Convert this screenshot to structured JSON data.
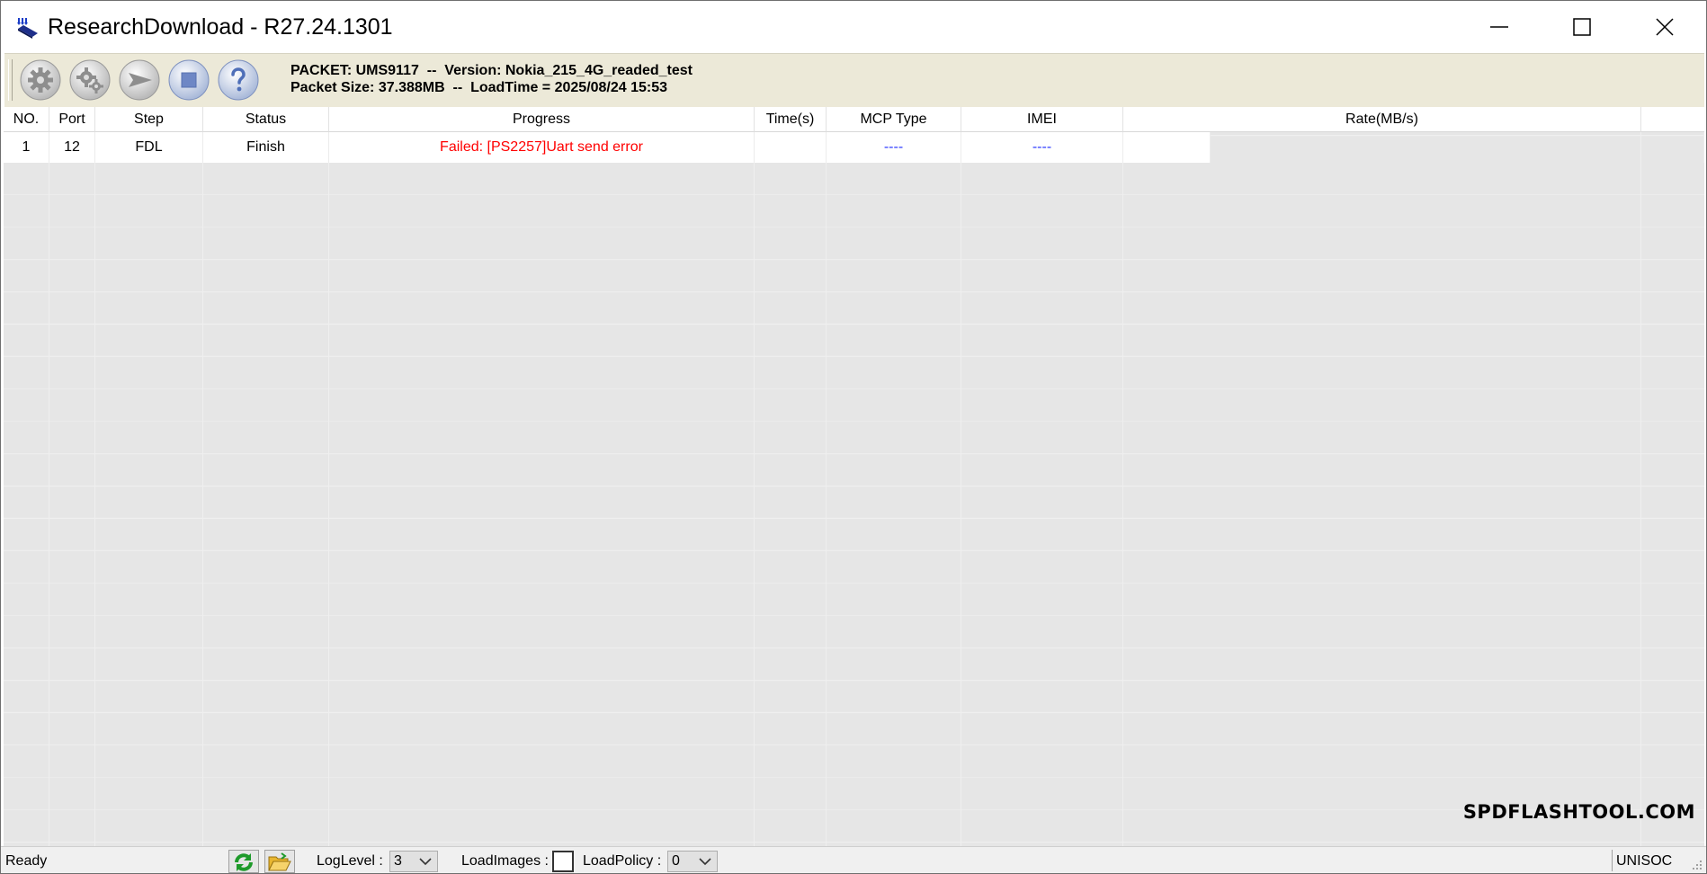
{
  "window": {
    "title": "ResearchDownload - R27.24.1301"
  },
  "toolbar": {
    "buttons": [
      {
        "name": "load-packet",
        "icon": "gear-icon"
      },
      {
        "name": "settings",
        "icon": "gears-icon"
      },
      {
        "name": "start",
        "icon": "play-arrow-icon"
      },
      {
        "name": "stop",
        "icon": "stop-icon"
      },
      {
        "name": "help",
        "icon": "help-icon"
      }
    ],
    "packet_line": "PACKET: UMS9117  --  Version: Nokia_215_4G_readed_test",
    "size_line": "Packet Size: 37.388MB  --  LoadTime = 2025/08/24 15:53"
  },
  "grid": {
    "columns": [
      "NO.",
      "Port",
      "Step",
      "Status",
      "Progress",
      "Time(s)",
      "MCP Type",
      "IMEI",
      "Rate(MB/s)"
    ],
    "rows": [
      {
        "no": "1",
        "port": "12",
        "step": "FDL",
        "status": "Finish",
        "progress": "Failed: [PS2257]Uart send error",
        "time": "",
        "mcp": "----",
        "imei": "----",
        "rate": ""
      }
    ]
  },
  "watermark": "SPDFLASHTOOL.COM",
  "statusbar": {
    "status": "Ready",
    "loglevel_label": "LogLevel :",
    "loglevel_value": "3",
    "loadimages_label": "LoadImages :",
    "loadpolicy_label": "LoadPolicy :",
    "loadpolicy_value": "0",
    "vendor": "UNISOC"
  },
  "colors": {
    "toolbar_bg": "#ece9d8",
    "grid_bg": "#e6e6e6",
    "error_text": "#ff0000",
    "dash_text": "#2b39ff"
  }
}
